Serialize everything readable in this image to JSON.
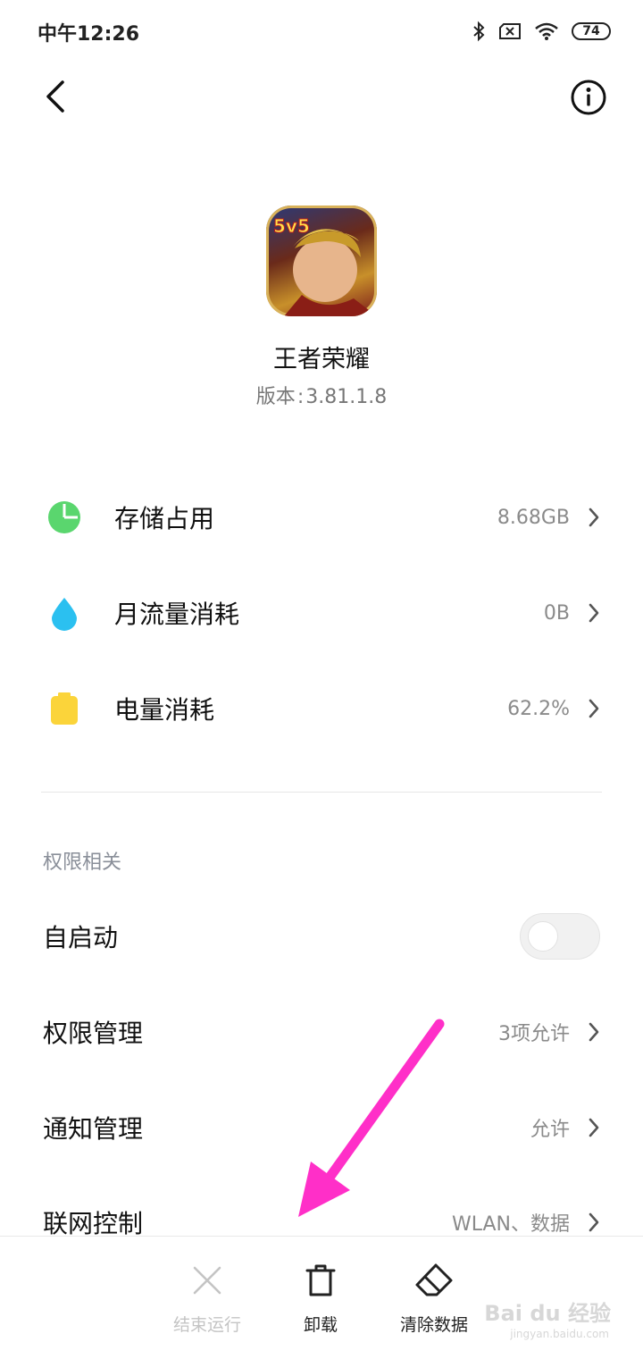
{
  "status_bar": {
    "time": "中午12:26",
    "battery": "74"
  },
  "app": {
    "name": "王者荣耀",
    "version_label": "版本",
    "version_sep": ":",
    "version": "3.81.1.8",
    "icon_text": "5v5"
  },
  "usage_rows": [
    {
      "label": "存储占用",
      "value": "8.68GB",
      "icon": "pie-chart-icon",
      "color": "#5ad66e"
    },
    {
      "label": "月流量消耗",
      "value": "0B",
      "icon": "water-drop-icon",
      "color": "#2bc0f0"
    },
    {
      "label": "电量消耗",
      "value": "62.2%",
      "icon": "battery-icon",
      "color": "#fbd43a"
    }
  ],
  "permissions": {
    "title": "权限相关",
    "autostart": {
      "label": "自启动",
      "enabled": false
    },
    "rows": [
      {
        "label": "权限管理",
        "value": "3项允许"
      },
      {
        "label": "通知管理",
        "value": "允许"
      },
      {
        "label": "联网控制",
        "value": "WLAN、数据"
      }
    ]
  },
  "bottom_actions": [
    {
      "label": "结束运行",
      "icon": "close-icon",
      "enabled": false
    },
    {
      "label": "卸载",
      "icon": "trash-icon",
      "enabled": true
    },
    {
      "label": "清除数据",
      "icon": "eraser-icon",
      "enabled": true
    }
  ],
  "watermark": {
    "text": "Bai du 经验",
    "sub": "jingyan.baidu.com"
  },
  "annotation": {
    "color": "#ff2fc8"
  }
}
